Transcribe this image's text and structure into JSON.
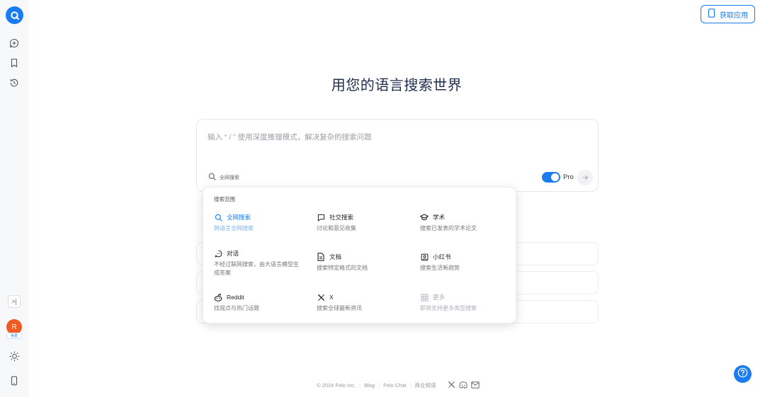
{
  "header": {
    "get_app_label": "获取应用"
  },
  "sidebar": {
    "items": [
      {
        "name": "new-thread",
        "icon": "plus-chat-icon"
      },
      {
        "name": "bookmarks",
        "icon": "bookmark-icon"
      },
      {
        "name": "history",
        "icon": "history-icon"
      }
    ],
    "collapse_symbol": ">|",
    "avatar_initial": "R",
    "avatar_badge": "免费"
  },
  "main": {
    "headline": "用您的语言搜索世界",
    "search": {
      "placeholder": "输入 “ / ” 使用深度推理模式，解决复杂的搜索问题",
      "scope_label": "全网搜索",
      "pro_label": "Pro",
      "pro_enabled": true
    }
  },
  "scope_menu": {
    "title": "搜索范围",
    "options": [
      {
        "label": "全网搜索",
        "desc": "跨语言全网搜索",
        "icon": "search-icon",
        "active": true
      },
      {
        "label": "社交搜索",
        "desc": "讨论和意见收集",
        "icon": "chat-square-icon"
      },
      {
        "label": "学术",
        "desc": "搜索已发表的学术论文",
        "icon": "graduation-cap-icon"
      },
      {
        "label": "对话",
        "desc": "不经过联网搜索，由大语言模型生成答案",
        "icon": "chat-bubble-icon"
      },
      {
        "label": "文档",
        "desc": "搜索特定格式的文档",
        "icon": "document-icon"
      },
      {
        "label": "小红书",
        "desc": "搜索生活新趋势",
        "icon": "xiaohongshu-icon"
      },
      {
        "label": "Reddit",
        "desc": "找观点与热门话题",
        "icon": "reddit-icon"
      },
      {
        "label": "X",
        "desc": "搜索全球最新资讯",
        "icon": "x-logo-icon"
      },
      {
        "label": "更多",
        "desc": "即将支持更多类型搜索",
        "icon": "grid-icon",
        "disabled": true
      }
    ]
  },
  "footer": {
    "copyright": "© 2024 Felo Inc.",
    "links": [
      "Blog",
      "Felo Chat",
      "商业频道"
    ]
  },
  "colors": {
    "accent": "#1a7cf0",
    "sidebar_bg": "#f7f8fa",
    "headline": "#1f2d4d"
  }
}
